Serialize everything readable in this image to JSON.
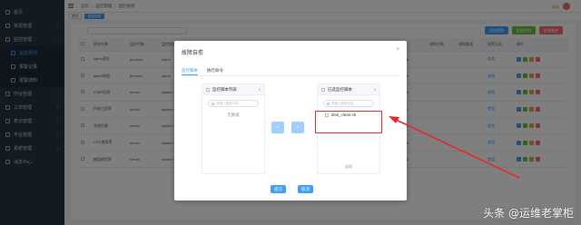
{
  "sidebar": {
    "items": [
      {
        "label": "首页"
      },
      {
        "label": "资源管理"
      },
      {
        "label": "监控管理"
      },
      {
        "label": "监控规则"
      },
      {
        "label": "报警记录"
      },
      {
        "label": "报警通知"
      },
      {
        "label": "作业管理"
      },
      {
        "label": "工单管理"
      },
      {
        "label": "表记管理"
      },
      {
        "label": "平台管理"
      },
      {
        "label": "系统管理"
      },
      {
        "label": "消息中心"
      }
    ]
  },
  "topbar": {
    "breadcrumb": [
      "首页",
      "监控管理",
      "监控规则"
    ],
    "right_label": "Ops"
  },
  "tags": [
    "首页",
    "监控规则"
  ],
  "toolbar": {
    "buttons": [
      "添加规则",
      "批量启用",
      "批量删除"
    ]
  },
  "table": {
    "columns": [
      "",
      "规则名称",
      "监控对象",
      "监控指标",
      "",
      "",
      "",
      "",
      "",
      "",
      "",
      "",
      "更新时间",
      "通知对象",
      "通知渠道",
      "报警记录",
      "操作"
    ],
    "rows": [
      {
        "name": "nginx进程",
        "obj": "process",
        "metric": "nginx",
        "time": "2022-09-06 21:31:06",
        "note": "查看"
      },
      {
        "name": "agent进程",
        "obj": "process",
        "metric": "agent",
        "time": "2022-09-06 21:35:00",
        "note": "查看"
      },
      {
        "name": "ICMP检测",
        "obj": "server",
        "metric": "system",
        "time": "2022-07-21 01:09:35",
        "note": "查看"
      },
      {
        "name": "内核占用率",
        "obj": "server",
        "metric": "system",
        "time": "2022-01-22 00:19:31",
        "note": "查看"
      },
      {
        "name": "系统负载",
        "obj": "server",
        "metric": "system",
        "time": "2022-01-03 23:59:54",
        "note": "查看"
      },
      {
        "name": "CPU使用率",
        "obj": "server",
        "metric": "system",
        "time": "2022-01-04 00:35:15",
        "note": "查看"
      },
      {
        "name": "磁盘使用率",
        "obj": "server",
        "metric": "system",
        "time": "2021-12-31 11:23:02",
        "note": "查看"
      }
    ]
  },
  "dialog": {
    "title": "故障自愈",
    "close": "×",
    "tabs": [
      "监控脚本",
      "执行命令"
    ],
    "left_panel": {
      "title": "监控脚本列表",
      "count": "0",
      "search_placeholder": "请输入搜索内容",
      "empty": "无数据"
    },
    "right_panel": {
      "title": "已选监控脚本",
      "count": "0",
      "search_placeholder": "请输入搜索内容",
      "item": "disk_clean.sh",
      "footer": "选取"
    },
    "transfer_left": "<",
    "transfer_right": ">",
    "submit": "提交",
    "cancel": "取消"
  },
  "watermark": "头条 @运维老掌柜",
  "colors": {
    "primary": "#409eff",
    "sidebar_bg": "#263445",
    "highlight": "#e02b2b"
  }
}
